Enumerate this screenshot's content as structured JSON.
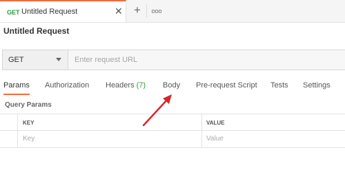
{
  "tabs": {
    "active": {
      "method": "GET",
      "name": "Untitled Request"
    },
    "close_symbol": "✕",
    "add_symbol": "+",
    "more_symbol": "ooo"
  },
  "request": {
    "title": "Untitled Request",
    "method": "GET",
    "url_placeholder": "Enter request URL",
    "url_value": ""
  },
  "subtabs": [
    {
      "label": "Params"
    },
    {
      "label": "Authorization"
    },
    {
      "label": "Headers",
      "count": "(7)"
    },
    {
      "label": "Body"
    },
    {
      "label": "Pre-request Script"
    },
    {
      "label": "Tests"
    },
    {
      "label": "Settings"
    }
  ],
  "active_subtab": "Params",
  "query_params": {
    "label": "Query Params",
    "columns": [
      "KEY",
      "VALUE"
    ],
    "placeholder_row": {
      "key": "Key",
      "value": "Value"
    }
  },
  "colors": {
    "accent": "#f26b3a",
    "method_green": "#2e9c3a",
    "annotation_arrow": "#d9262c"
  }
}
